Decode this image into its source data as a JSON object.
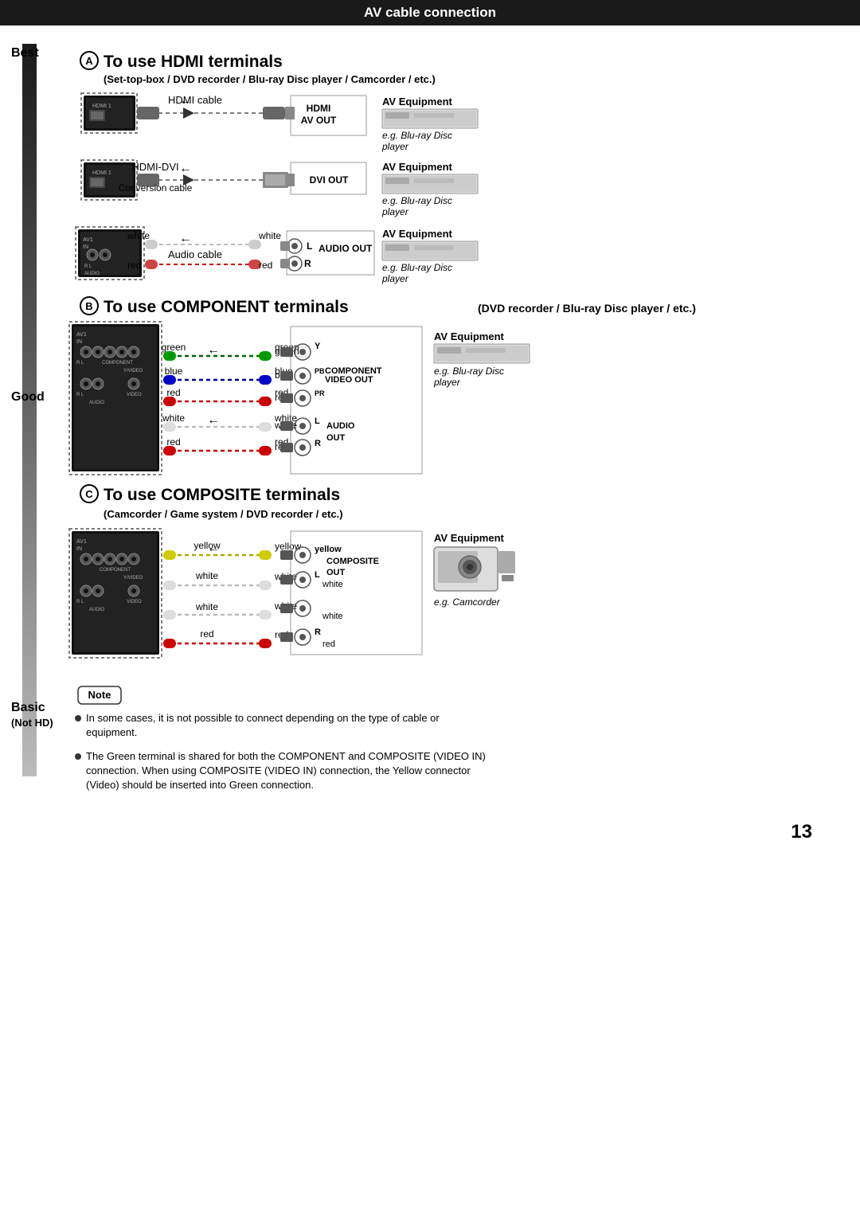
{
  "header": {
    "title": "AV cable connection"
  },
  "page_number": "13",
  "quality_labels": {
    "best": "Best",
    "good": "Good",
    "basic": "Basic",
    "not_hd": "(Not HD)"
  },
  "section_a": {
    "circle_label": "A",
    "title": "To use HDMI terminals",
    "subtitle": "(Set-top-box / DVD recorder / Blu-ray Disc player / Camcorder / etc.)",
    "row1": {
      "cable_label": "HDMI cable",
      "equipment_out": "HDMI\nAV OUT",
      "equipment_type": "AV Equipment",
      "equipment_example": "e.g. Blu-ray Disc player"
    },
    "row2": {
      "cable_label": "HDMI-DVI\nConversion cable",
      "equipment_out": "DVI OUT",
      "equipment_type": "AV Equipment",
      "equipment_example": "e.g. Blu-ray Disc player"
    },
    "row3": {
      "cable_label": "Audio cable",
      "left_white": "white",
      "left_red": "red",
      "right_white": "white",
      "right_red": "red",
      "equipment_out": "AUDIO OUT",
      "equipment_out_lr": "L\nR",
      "equipment_type": "AV Equipment",
      "equipment_example": "e.g. Blu-ray Disc player"
    }
  },
  "section_b": {
    "circle_label": "B",
    "title": "To use COMPONENT terminals",
    "subtitle": "(DVD recorder / Blu-ray Disc player / etc.)",
    "colors": {
      "green": "green",
      "blue": "blue",
      "red": "red",
      "white": "white",
      "red2": "red"
    },
    "component_labels": {
      "y": "Y",
      "pb": "PB",
      "pr": "PR",
      "video_out": "COMPONENT\nVIDEO OUT"
    },
    "audio_labels": {
      "l": "L",
      "r": "R",
      "audio_out": "AUDIO\nOUT"
    },
    "equipment_type": "AV Equipment",
    "equipment_example": "e.g. Blu-ray Disc player"
  },
  "section_c": {
    "circle_label": "C",
    "title": "To use COMPOSITE terminals",
    "subtitle": "(Camcorder / Game system / DVD recorder / etc.)",
    "colors": {
      "yellow": "yellow",
      "white": "white",
      "red": "red"
    },
    "composite_labels": {
      "out": "COMPOSITE\nOUT",
      "l": "L",
      "r": "R"
    },
    "equipment_type": "AV Equipment",
    "equipment_example": "e.g. Camcorder"
  },
  "notes": {
    "label": "Note",
    "items": [
      "In some cases, it is not possible to connect depending on the type of cable or equipment.",
      "The Green terminal is shared for both the COMPONENT and COMPOSITE (VIDEO IN) connection. When using COMPOSITE (VIDEO IN) connection, the Yellow connector (Video) should be inserted into Green connection."
    ]
  }
}
